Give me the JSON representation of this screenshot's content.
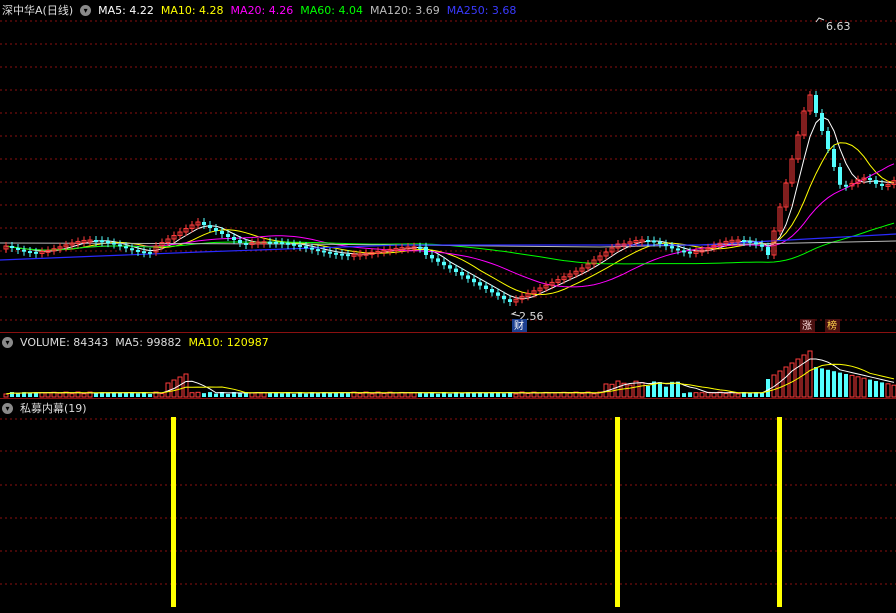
{
  "main_header": {
    "stock": "深中华A(日线)",
    "ma5": "MA5: 4.22",
    "ma10": "MA10: 4.28",
    "ma20": "MA20: 4.26",
    "ma60": "MA60: 4.04",
    "ma120": "MA120: 3.69",
    "ma250": "MA250: 3.68"
  },
  "price_labels": {
    "high": "6.63",
    "low": "2.56"
  },
  "event_tags": {
    "cai": "财",
    "zhang": "涨",
    "bang": "榜"
  },
  "volume_header": {
    "volume": "VOLUME: 84343",
    "ma5": "MA5: 99882",
    "ma10": "MA10: 120987"
  },
  "indicator_header": {
    "name": "私募内幕(19)"
  },
  "colors": {
    "up": "#ff3c3c",
    "down": "#54ffff",
    "ma5": "#ffffff",
    "ma10": "#ffff00",
    "ma20": "#ff00ff",
    "ma60": "#00ff00",
    "ma120": "#bbbbbb",
    "ma250": "#2a2aff",
    "signal": "#ffff00",
    "grid": "#8a1010"
  },
  "indicator_signals": [
    {
      "index": 28,
      "value": 1
    },
    {
      "index": 102,
      "value": 1
    },
    {
      "index": 129,
      "value": 1
    }
  ]
}
